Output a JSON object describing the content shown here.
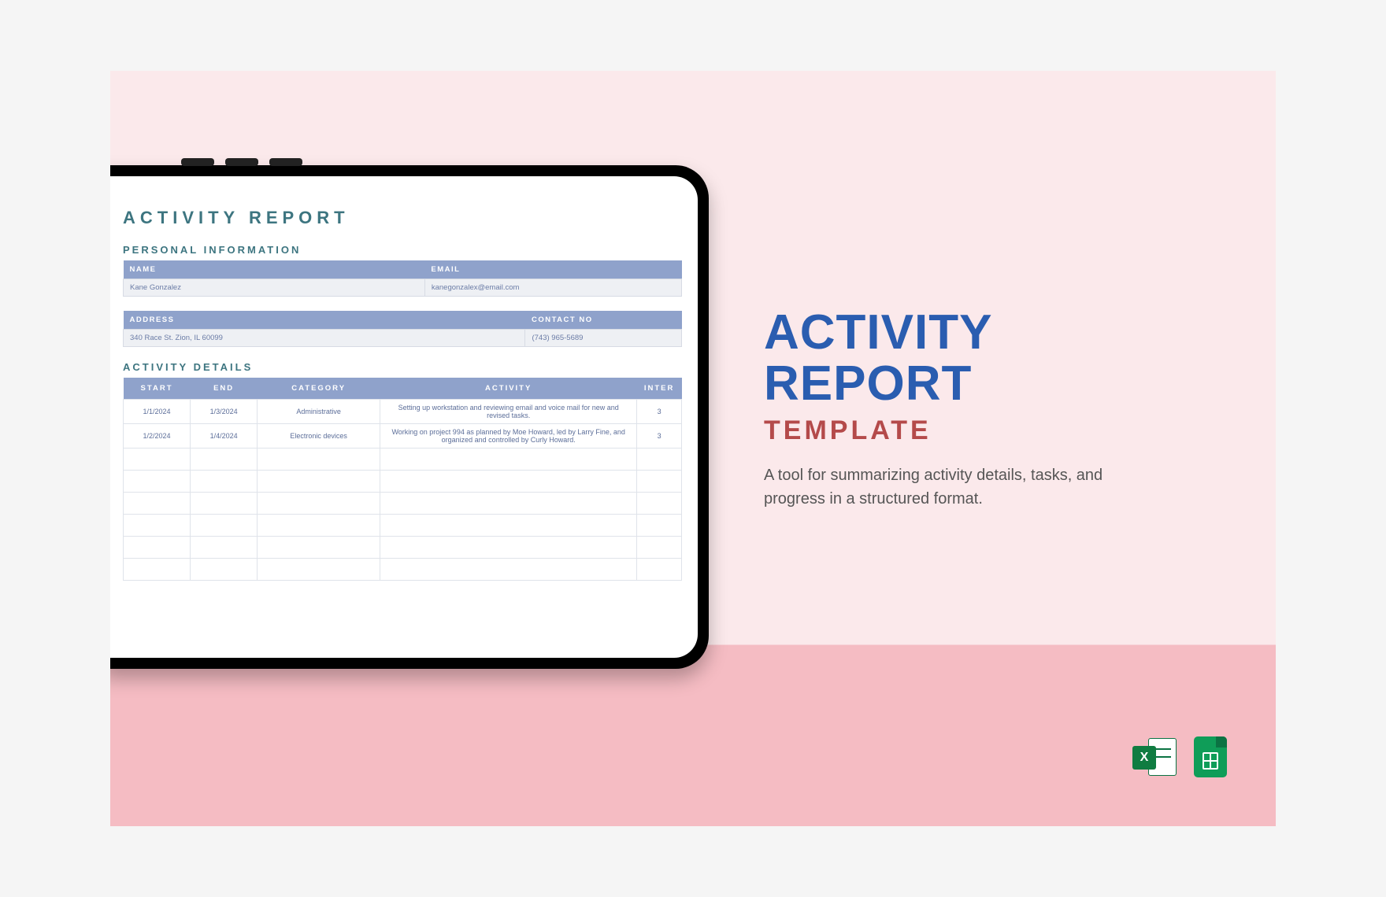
{
  "promo": {
    "title_line1": "ACTIVITY",
    "title_line2": "REPORT",
    "template_label": "TEMPLATE",
    "description": "A tool for summarizing activity details, tasks, and progress in a structured format."
  },
  "report": {
    "title": "ACTIVITY REPORT",
    "personal_label": "PERSONAL INFORMATION",
    "name_header": "NAME",
    "name_value": "Kane Gonzalez",
    "email_header": "EMAIL",
    "email_value": "kanegonzalex@email.com",
    "address_header": "ADDRESS",
    "address_value": "340 Race St. Zion, IL 60099",
    "contact_header": "CONTACT NO",
    "contact_value": "(743) 965-5689",
    "details_label": "ACTIVITY DETAILS",
    "details_headers": {
      "start": "START",
      "end": "END",
      "category": "CATEGORY",
      "activity": "ACTIVITY",
      "inter": "INTER"
    },
    "details_rows": [
      {
        "start": "1/1/2024",
        "end": "1/3/2024",
        "category": "Administrative",
        "activity": "Setting up workstation and reviewing email and voice mail for new and revised tasks.",
        "inter": "3"
      },
      {
        "start": "1/2/2024",
        "end": "1/4/2024",
        "category": "Electronic devices",
        "activity": "Working on project 994 as planned by Moe Howard, led by Larry Fine, and organized and controlled by Curly Howard.",
        "inter": "3"
      }
    ]
  },
  "icons": {
    "excel_glyph": "X"
  }
}
